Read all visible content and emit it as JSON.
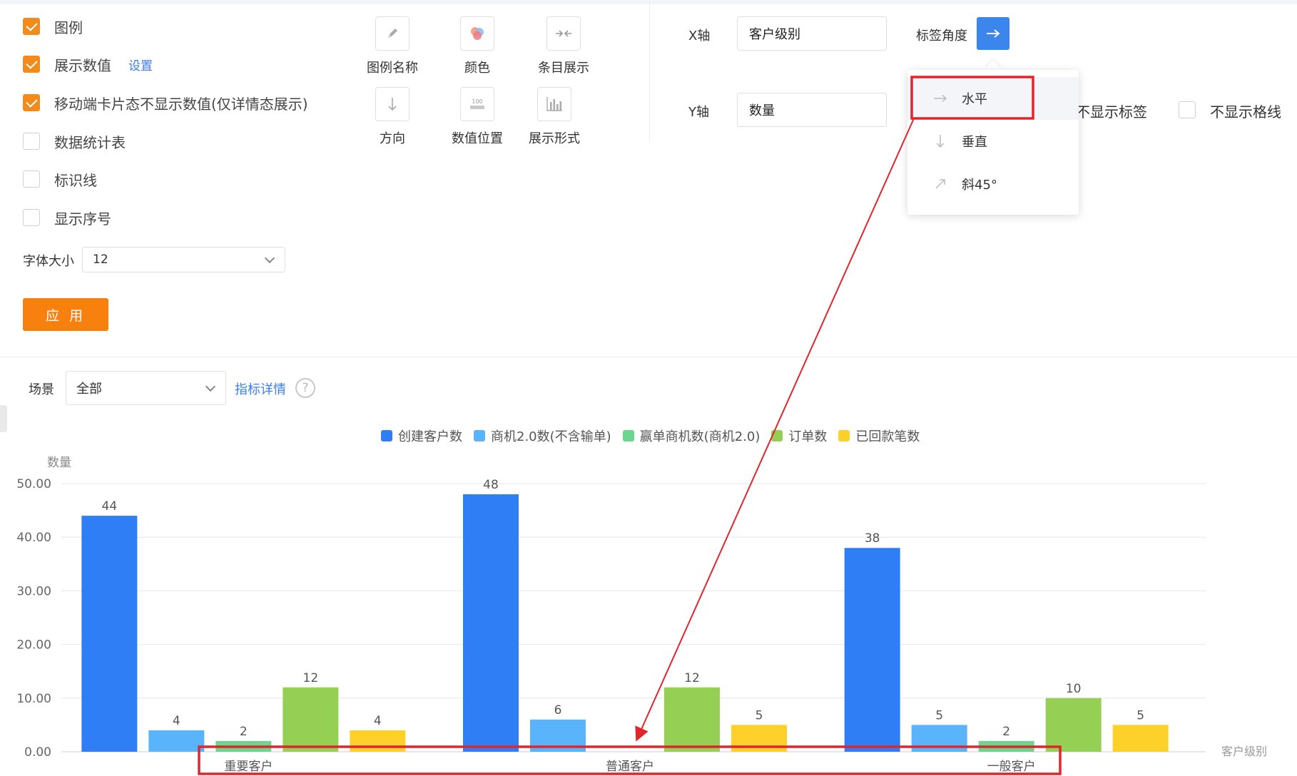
{
  "options": {
    "legend": {
      "label": "图例",
      "checked": true
    },
    "show_values": {
      "label": "展示数值",
      "checked": true,
      "link": "设置"
    },
    "mobile_hide": {
      "label": "移动端卡片态不显示数值(仅详情态展示)",
      "checked": true
    },
    "data_table": {
      "label": "数据统计表",
      "checked": false
    },
    "mark_line": {
      "label": "标识线",
      "checked": false
    },
    "show_index": {
      "label": "显示序号",
      "checked": false
    }
  },
  "font_size": {
    "label": "字体大小",
    "value": "12"
  },
  "apply_label": "应 用",
  "tools": [
    {
      "label": "图例名称",
      "icon": "pencil-icon"
    },
    {
      "label": "颜色",
      "icon": "color-palette-icon"
    },
    {
      "label": "条目展示",
      "icon": "collapse-arrows-icon"
    },
    {
      "label": "方向",
      "icon": "arrow-down-icon"
    },
    {
      "label": "数值位置",
      "icon": "value-position-icon"
    },
    {
      "label": "展示形式",
      "icon": "bar-chart-icon"
    }
  ],
  "axis": {
    "x_label": "X轴",
    "x_value": "客户级别",
    "y_label": "Y轴",
    "y_value": "数量",
    "label_angle": "标签角度",
    "hide_label": "不显示标签",
    "hide_grid": "不显示格线"
  },
  "angle_options": [
    {
      "label": "水平",
      "icon": "arrow-right-icon",
      "selected": true
    },
    {
      "label": "垂直",
      "icon": "arrow-down-icon",
      "selected": false
    },
    {
      "label": "斜45°",
      "icon": "arrow-diagonal-icon",
      "selected": false
    }
  ],
  "scene": {
    "label": "场景",
    "value": "全部",
    "detail_link": "指标详情",
    "help": "?"
  },
  "colors": {
    "accent": "#f38a1a",
    "link": "#3b7cf2",
    "highlight": "#e0252d"
  },
  "chart_data": {
    "type": "bar",
    "ylabel": "数量",
    "xlabel": "客户级别",
    "ylim": [
      0,
      50
    ],
    "yticks": [
      "0.00",
      "10.00",
      "20.00",
      "30.00",
      "40.00",
      "50.00"
    ],
    "categories": [
      "重要客户",
      "普通客户",
      "一般客户"
    ],
    "series": [
      {
        "name": "创建客户数",
        "color": "#2f7ef5",
        "values": [
          44,
          48,
          38
        ]
      },
      {
        "name": "商机2.0数(不含输单)",
        "color": "#5ab4fc",
        "values": [
          4,
          6,
          5
        ]
      },
      {
        "name": "赢单商机数(商机2.0)",
        "color": "#6cd68f",
        "values": [
          2,
          0,
          2
        ]
      },
      {
        "name": "订单数",
        "color": "#95cf53",
        "values": [
          12,
          12,
          10
        ]
      },
      {
        "name": "已回款笔数",
        "color": "#fdd12a",
        "values": [
          4,
          5,
          5
        ]
      }
    ],
    "grid": true,
    "legend_position": "top-center"
  }
}
